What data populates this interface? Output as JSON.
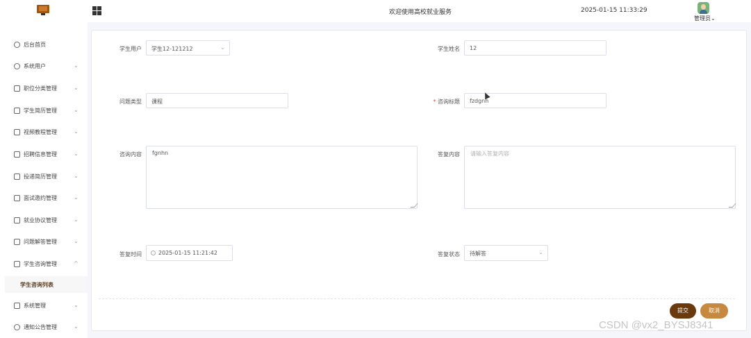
{
  "header": {
    "title": "欢迎使用高校就业服务",
    "datetime": "2025-01-15 11:33:29",
    "user": "管理员",
    "user_arrow": "⌄"
  },
  "sidebar": {
    "items": [
      {
        "label": "后台首页",
        "icon": "clock-icon",
        "arrow": ""
      },
      {
        "label": "系统用户",
        "icon": "user-icon",
        "arrow": "⌄"
      },
      {
        "label": "职位分类管理",
        "icon": "list-icon",
        "arrow": "⌄"
      },
      {
        "label": "学生简历管理",
        "icon": "list-icon",
        "arrow": "⌄"
      },
      {
        "label": "视频教程管理",
        "icon": "list-icon",
        "arrow": "⌄"
      },
      {
        "label": "招聘信息管理",
        "icon": "list-icon",
        "arrow": "⌄"
      },
      {
        "label": "投递简历管理",
        "icon": "list-icon",
        "arrow": "⌄"
      },
      {
        "label": "面试邀约管理",
        "icon": "list-icon",
        "arrow": "⌄"
      },
      {
        "label": "就业协议管理",
        "icon": "list-icon",
        "arrow": "⌄"
      },
      {
        "label": "问题解答管理",
        "icon": "list-icon",
        "arrow": "⌄"
      },
      {
        "label": "学生咨询管理",
        "icon": "list-icon",
        "arrow": "^"
      },
      {
        "label": "系统管理",
        "icon": "folder-icon",
        "arrow": "⌄"
      },
      {
        "label": "通知公告管理",
        "icon": "gear-icon",
        "arrow": "⌄"
      }
    ],
    "active_sub": "学生咨询列表"
  },
  "form": {
    "student_user_label": "学生用户",
    "student_user_value": "学生12-121212",
    "student_name_label": "学生姓名",
    "student_name_value": "12",
    "question_type_label": "问题类型",
    "question_type_value": "课程",
    "consult_title_required": "*",
    "consult_title_label": "咨询标题",
    "consult_title_value": "fzdgnh",
    "consult_content_label": "咨询内容",
    "consult_content_value": "fgnhn",
    "answer_content_label": "答复内容",
    "answer_content_placeholder": "请输入答复内容",
    "answer_time_label": "答复时间",
    "answer_time_value": "2025-01-15 11:21:42",
    "answer_status_label": "答复状态",
    "answer_status_value": "待解答"
  },
  "buttons": {
    "submit": "提交",
    "cancel": "取消"
  },
  "watermark": "CSDN @vx2_BYSJ8341"
}
